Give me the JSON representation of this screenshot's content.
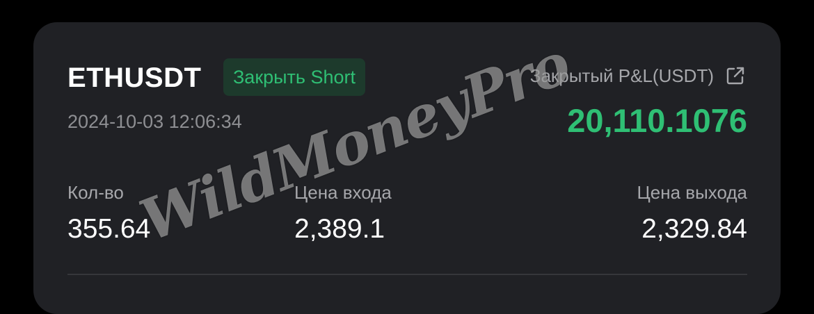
{
  "trade": {
    "symbol": "ETHUSDT",
    "side_label": "Закрыть Short",
    "timestamp": "2024-10-03 12:06:34"
  },
  "pnl": {
    "label": "Закрытый P&L(USDT)",
    "value": "20,110.1076",
    "icon": "external-link-icon"
  },
  "stats": {
    "qty_label": "Кол-во",
    "qty_value": "355.64",
    "entry_label": "Цена входа",
    "entry_value": "2,389.1",
    "exit_label": "Цена выхода",
    "exit_value": "2,329.84"
  },
  "watermark": {
    "text": "WildMoneyPro"
  },
  "colors": {
    "background": "#000000",
    "card": "#202125",
    "accent_green": "#2fbf74",
    "badge_bg": "#1d3a2c",
    "muted_text": "#8e8f93"
  }
}
